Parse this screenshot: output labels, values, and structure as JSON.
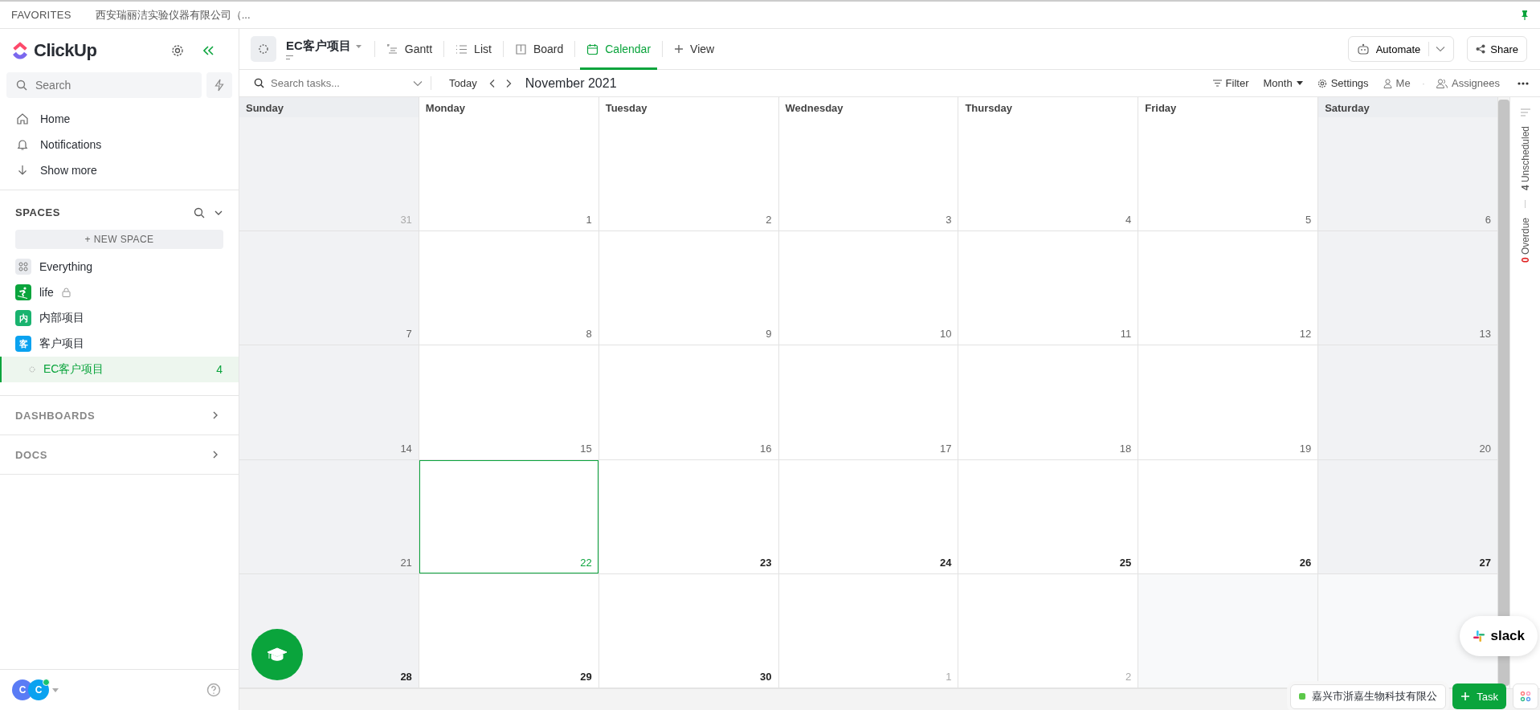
{
  "favorites": {
    "label": "FAVORITES",
    "items": [
      "西安瑞丽洁实验仪器有限公司（..."
    ]
  },
  "sidebar": {
    "logo": "ClickUp",
    "search": {
      "placeholder": "Search"
    },
    "nav": [
      {
        "label": "Home",
        "kind": "home"
      },
      {
        "label": "Notifications",
        "kind": "bell"
      },
      {
        "label": "Show more",
        "kind": "down"
      }
    ],
    "spaces_title": "SPACES",
    "new_space": "+ NEW SPACE",
    "spaces": [
      {
        "label": "Everything",
        "kind": "grid",
        "color": "#e8eaee",
        "selected": false
      },
      {
        "label": "life",
        "kind": "ski",
        "color": "#0aa43c",
        "locked": true,
        "selected": false
      },
      {
        "label": "内部项目",
        "kind": "letter",
        "badge": "内",
        "color": "#19b36f",
        "selected": false
      },
      {
        "label": "客户项目",
        "kind": "letter",
        "badge": "客",
        "color": "#0aa2f0",
        "selected": false
      },
      {
        "label": "EC客户项目",
        "kind": "list",
        "count": "4",
        "selected": true
      }
    ],
    "sections": [
      "DASHBOARDS",
      "DOCS"
    ],
    "avatars": [
      {
        "initial": "C",
        "color": "#5a7cf5"
      },
      {
        "initial": "C",
        "color": "#0aa2f0",
        "online": true
      }
    ]
  },
  "header": {
    "title": "EC客户项目",
    "views": [
      {
        "label": "Gantt",
        "kind": "gantt",
        "selected": false
      },
      {
        "label": "List",
        "kind": "list",
        "selected": false
      },
      {
        "label": "Board",
        "kind": "board",
        "selected": false
      },
      {
        "label": "Calendar",
        "kind": "calendar",
        "selected": true
      }
    ],
    "add_view": "View",
    "automate": "Automate",
    "share": "Share"
  },
  "toolbar": {
    "search": {
      "placeholder": "Search tasks..."
    },
    "today": "Today",
    "month_label": "November 2021",
    "filter": "Filter",
    "mode": "Month",
    "settings": "Settings",
    "me": "Me",
    "separator": "·",
    "assignees": "Assignees"
  },
  "calendar": {
    "columns": [
      {
        "name": "Sunday",
        "weekend": true
      },
      {
        "name": "Monday",
        "weekend": false
      },
      {
        "name": "Tuesday",
        "weekend": false
      },
      {
        "name": "Wednesday",
        "weekend": false
      },
      {
        "name": "Thursday",
        "weekend": false
      },
      {
        "name": "Friday",
        "weekend": false
      },
      {
        "name": "Saturday",
        "weekend": true
      }
    ],
    "weeks": [
      [
        {
          "label": "31",
          "kind": "other"
        },
        {
          "label": "1",
          "kind": "past"
        },
        {
          "label": "2",
          "kind": "past"
        },
        {
          "label": "3",
          "kind": "past"
        },
        {
          "label": "4",
          "kind": "past"
        },
        {
          "label": "5",
          "kind": "past"
        },
        {
          "label": "6",
          "kind": "past"
        }
      ],
      [
        {
          "label": "7",
          "kind": "past"
        },
        {
          "label": "8",
          "kind": "past"
        },
        {
          "label": "9",
          "kind": "past"
        },
        {
          "label": "10",
          "kind": "past"
        },
        {
          "label": "11",
          "kind": "past"
        },
        {
          "label": "12",
          "kind": "past"
        },
        {
          "label": "13",
          "kind": "past"
        }
      ],
      [
        {
          "label": "14",
          "kind": "past"
        },
        {
          "label": "15",
          "kind": "past"
        },
        {
          "label": "16",
          "kind": "past"
        },
        {
          "label": "17",
          "kind": "past"
        },
        {
          "label": "18",
          "kind": "past"
        },
        {
          "label": "19",
          "kind": "past"
        },
        {
          "label": "20",
          "kind": "past"
        }
      ],
      [
        {
          "label": "21",
          "kind": "past"
        },
        {
          "label": "22",
          "kind": "today"
        },
        {
          "label": "23",
          "kind": "future"
        },
        {
          "label": "24",
          "kind": "future"
        },
        {
          "label": "25",
          "kind": "future"
        },
        {
          "label": "26",
          "kind": "future"
        },
        {
          "label": "27",
          "kind": "future"
        }
      ],
      [
        {
          "label": "28",
          "kind": "future"
        },
        {
          "label": "29",
          "kind": "future"
        },
        {
          "label": "30",
          "kind": "future"
        },
        {
          "label": "1",
          "kind": "other"
        },
        {
          "label": "2",
          "kind": "other"
        },
        {
          "kind": "hidden"
        },
        {
          "kind": "hidden"
        }
      ]
    ]
  },
  "side_panel": {
    "unscheduled_count": "4",
    "unscheduled": "Unscheduled",
    "overdue_count": "0",
    "overdue": "Overdue"
  },
  "bottom": {
    "tray_item": "嘉兴市浙嘉生物科技有限公",
    "add_task": "Task",
    "slack": "slack"
  }
}
